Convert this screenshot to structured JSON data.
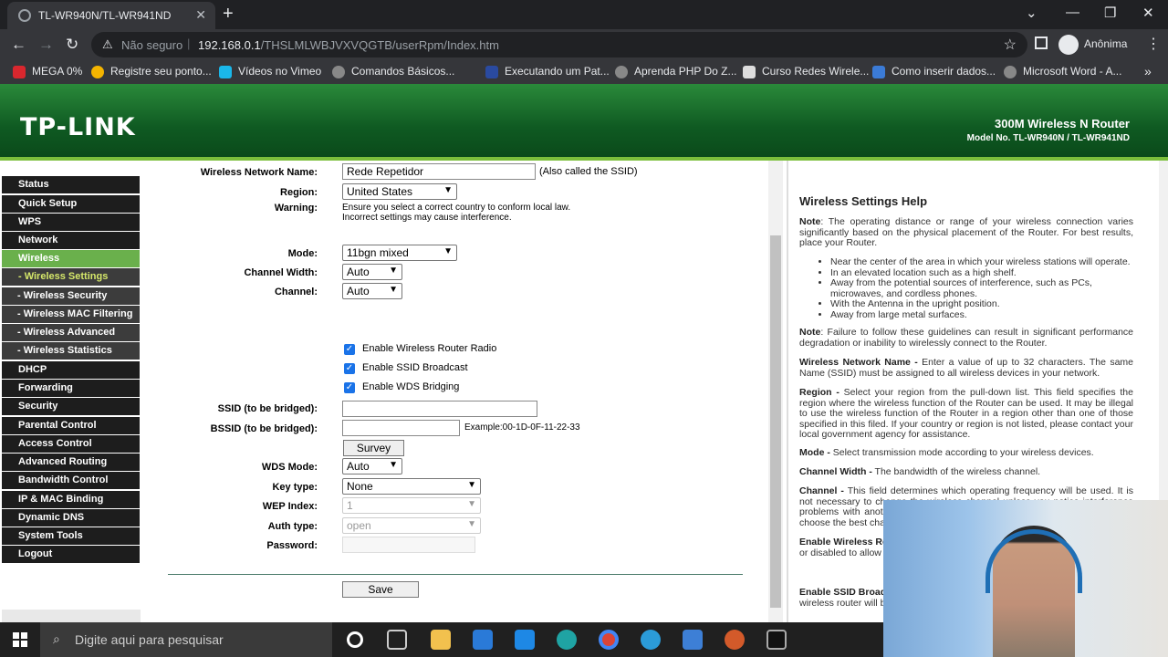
{
  "browser": {
    "tab_title": "TL-WR940N/TL-WR941ND",
    "security_text": "Não seguro",
    "url_host": "192.168.0.1",
    "url_path": "/THSLMLWBJVXVQGTB/userRpm/Index.htm",
    "profile_name": "Anônima",
    "bookmarks": [
      "MEGA 0%",
      "Registre seu ponto...",
      "Vídeos no Vimeo",
      "Comandos Básicos...",
      "Executando um Pat...",
      "Aprenda PHP Do Z...",
      "Curso Redes Wirele...",
      "Como inserir dados...",
      "Microsoft Word - A..."
    ]
  },
  "router": {
    "logo": "TP-LINK",
    "product": "300M Wireless N Router",
    "model": "Model No. TL-WR940N / TL-WR941ND",
    "menu": [
      "Status",
      "Quick Setup",
      "WPS",
      "Network",
      "Wireless",
      "- Wireless Settings",
      "- Wireless Security",
      "- Wireless MAC Filtering",
      "- Wireless Advanced",
      "- Wireless Statistics",
      "DHCP",
      "Forwarding",
      "Security",
      "Parental Control",
      "Access Control",
      "Advanced Routing",
      "Bandwidth Control",
      "IP & MAC Binding",
      "Dynamic DNS",
      "System Tools",
      "Logout"
    ],
    "form": {
      "network_name_label": "Wireless Network Name:",
      "network_name_value": "Rede Repetidor",
      "network_name_note": "(Also called the SSID)",
      "region_label": "Region:",
      "region_value": "United States",
      "warning_label": "Warning:",
      "warning_line1": "Ensure you select a correct country to conform local law.",
      "warning_line2": "Incorrect settings may cause interference.",
      "mode_label": "Mode:",
      "mode_value": "11bgn mixed",
      "channel_width_label": "Channel Width:",
      "channel_width_value": "Auto",
      "channel_label": "Channel:",
      "channel_value": "Auto",
      "enable_radio": "Enable Wireless Router Radio",
      "enable_ssid_broadcast": "Enable SSID Broadcast",
      "enable_wds": "Enable WDS Bridging",
      "ssid_bridged_label": "SSID (to be bridged):",
      "bssid_bridged_label": "BSSID (to be bridged):",
      "bssid_example": "Example:00-1D-0F-11-22-33",
      "survey_button": "Survey",
      "wds_mode_label": "WDS Mode:",
      "wds_mode_value": "Auto",
      "key_type_label": "Key type:",
      "key_type_value": "None",
      "wep_index_label": "WEP Index:",
      "wep_index_value": "1",
      "auth_type_label": "Auth type:",
      "auth_type_value": "open",
      "password_label": "Password:",
      "save_button": "Save"
    },
    "help": {
      "title": "Wireless Settings Help",
      "note1_label": "Note",
      "note1_text": ": The operating distance or range of your wireless connection varies significantly based on the physical placement of the Router. For best results, place your Router.",
      "bullets": [
        "Near the center of the area in which your wireless stations will operate.",
        "In an elevated location such as a high shelf.",
        "Away from the potential sources of interference, such as PCs, microwaves, and cordless phones.",
        "With the Antenna in the upright position.",
        "Away from large metal surfaces."
      ],
      "note2_label": "Note",
      "note2_text": ": Failure to follow these guidelines can result in significant performance degradation or inability to wirelessly connect to the Router.",
      "wnn_label": "Wireless Network Name -",
      "wnn_text": " Enter a value of up to 32 characters. The same Name (SSID) must be assigned to all wireless devices in your network.",
      "region_label": "Region -",
      "region_text": " Select your region from the pull-down list. This field specifies the region where the wireless function of the Router can be used. It may be illegal to use the wireless function of the Router in a region other than one of those specified in this filed. If your country or region is not listed, please contact your local government agency for assistance.",
      "mode_label": "Mode -",
      "mode_text": " Select transmission mode according to your wireless devices.",
      "cw_label": "Channel Width -",
      "cw_text": " The bandwidth of the wireless channel.",
      "channel_label": "Channel -",
      "channel_text": " This field determines which operating frequency will be used. It is not necessary to change the wireless channel unless you notice interference problems with another nearby access point. If you select auto, then AP will choose the best channel automatically.",
      "ewr_label": "Enable Wireless Ro",
      "ewr_text": "or disabled to allow w... be able to access the R... Router.",
      "ssid_b_label": "Enable SSID Broad",
      "ssid_b_text": "wireless router will b..."
    }
  },
  "taskbar": {
    "search_placeholder": "Digite aqui para pesquisar"
  }
}
